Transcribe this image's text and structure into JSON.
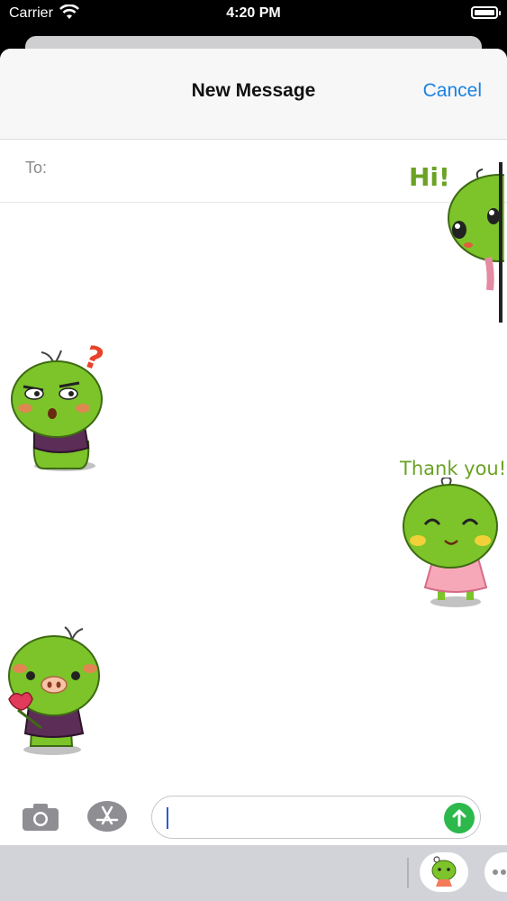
{
  "status_bar": {
    "carrier": "Carrier",
    "time": "4:20 PM"
  },
  "nav": {
    "title": "New Message",
    "cancel_label": "Cancel"
  },
  "compose": {
    "to_label": "To:"
  },
  "stickers": {
    "hi": "Hi!",
    "question": "?",
    "thank_you": "Thank you!"
  },
  "colors": {
    "accent": "#1a82e2",
    "send": "#2db84c",
    "sticker_green": "#7cc42a",
    "sticker_text": "#6aa224"
  },
  "icons": [
    "wifi-icon",
    "battery-icon",
    "camera-icon",
    "app-store-icon",
    "send-arrow-icon",
    "sticker-app-icon",
    "more-icon"
  ]
}
